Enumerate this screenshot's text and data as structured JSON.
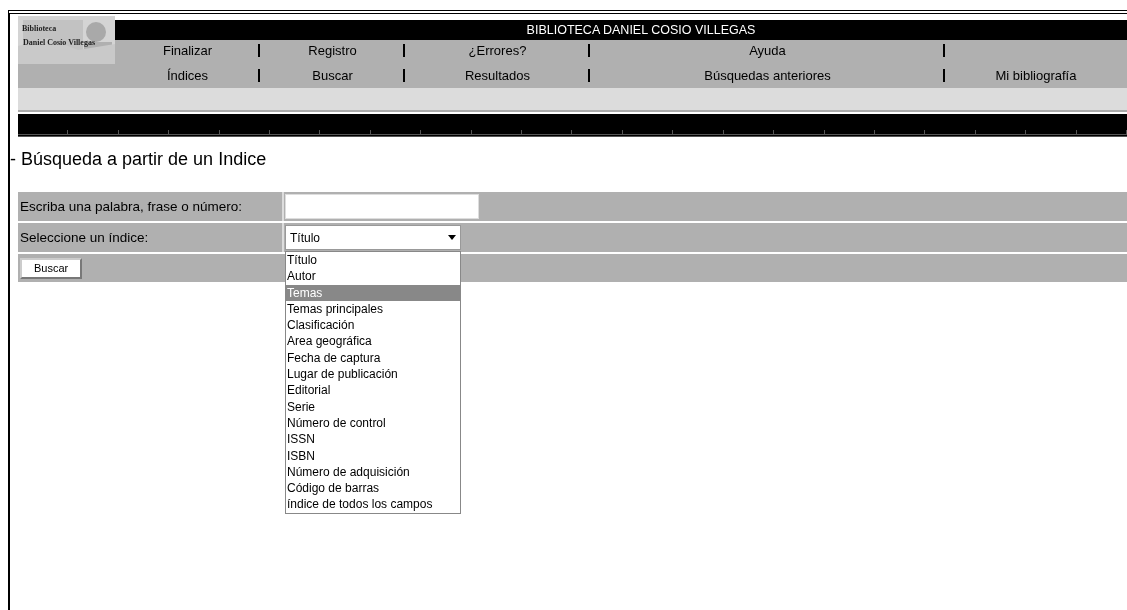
{
  "logo": {
    "lines": [
      "Biblioteca",
      "Daniel Cosío Villegas"
    ]
  },
  "header": {
    "title": "BIBLIOTECA DANIEL COSIO VILLEGAS"
  },
  "nav_rows": [
    [
      "Finalizar",
      "Registro",
      "¿Errores?",
      "Ayuda",
      ""
    ],
    [
      "Índices",
      "Buscar",
      "Resultados",
      "Búsquedas anteriores",
      "Mi bibliografía"
    ]
  ],
  "page_title": "- Búsqueda a partir de un Indice",
  "form": {
    "search_label": "Escriba una palabra, frase o número:",
    "index_label": "Seleccione un índice:",
    "index_value": "Título",
    "button": "Buscar"
  },
  "dropdown": {
    "expanded": true,
    "options": [
      {
        "label": "Título",
        "selected": false
      },
      {
        "label": "Autor",
        "selected": false
      },
      {
        "label": "Temas",
        "selected": true
      },
      {
        "label": "Temas principales",
        "selected": false
      },
      {
        "label": "Clasificación",
        "selected": false
      },
      {
        "label": "Area geográfica",
        "selected": false
      },
      {
        "label": "Fecha de captura",
        "selected": false
      },
      {
        "label": "Lugar de publicación",
        "selected": false
      },
      {
        "label": "Editorial",
        "selected": false
      },
      {
        "label": "Serie",
        "selected": false
      },
      {
        "label": "Número de control",
        "selected": false
      },
      {
        "label": "ISSN",
        "selected": false
      },
      {
        "label": "ISBN",
        "selected": false
      },
      {
        "label": "Número de adquisición",
        "selected": false
      },
      {
        "label": "Código de barras",
        "selected": false
      },
      {
        "label": "índice de todos los campos",
        "selected": false
      }
    ]
  }
}
